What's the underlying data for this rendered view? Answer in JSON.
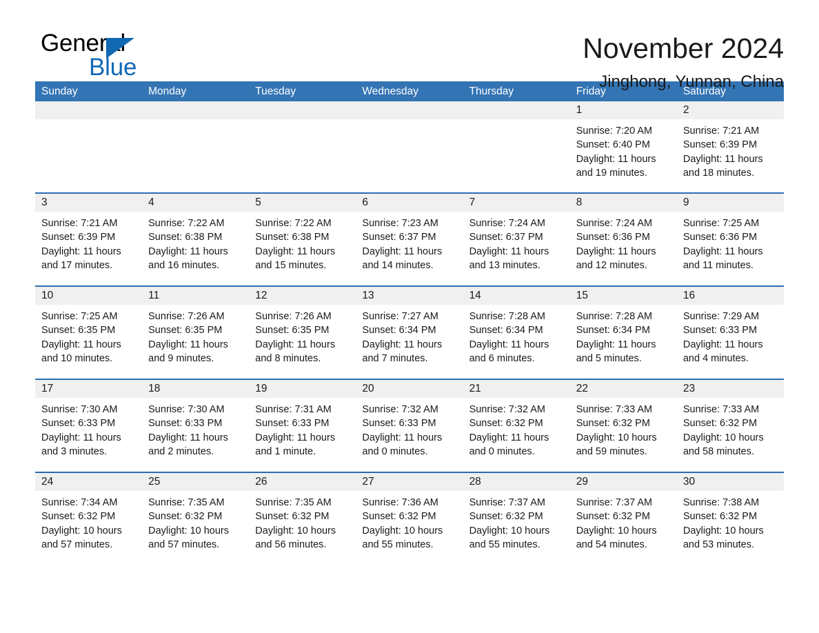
{
  "brand": {
    "name_part1": "General",
    "name_part2": "Blue",
    "triangle_icon": "triangle-logo-icon",
    "accent_color": "#1268b3"
  },
  "header": {
    "title": "November 2024",
    "subtitle": "Jinghong, Yunnan, China"
  },
  "theme": {
    "header_row_color": "#3374b4",
    "row_divider_color": "#2a6db0",
    "day_band_color": "#f0f0f0",
    "text_color": "#1a1a1a"
  },
  "calendar": {
    "weekdays": [
      "Sunday",
      "Monday",
      "Tuesday",
      "Wednesday",
      "Thursday",
      "Friday",
      "Saturday"
    ],
    "weeks": [
      [
        {
          "day": "",
          "empty": true,
          "lines": []
        },
        {
          "day": "",
          "empty": true,
          "lines": []
        },
        {
          "day": "",
          "empty": true,
          "lines": []
        },
        {
          "day": "",
          "empty": true,
          "lines": []
        },
        {
          "day": "",
          "empty": true,
          "lines": []
        },
        {
          "day": "1",
          "empty": false,
          "lines": [
            "Sunrise: 7:20 AM",
            "Sunset: 6:40 PM",
            "Daylight: 11 hours",
            "and 19 minutes."
          ]
        },
        {
          "day": "2",
          "empty": false,
          "lines": [
            "Sunrise: 7:21 AM",
            "Sunset: 6:39 PM",
            "Daylight: 11 hours",
            "and 18 minutes."
          ]
        }
      ],
      [
        {
          "day": "3",
          "empty": false,
          "lines": [
            "Sunrise: 7:21 AM",
            "Sunset: 6:39 PM",
            "Daylight: 11 hours",
            "and 17 minutes."
          ]
        },
        {
          "day": "4",
          "empty": false,
          "lines": [
            "Sunrise: 7:22 AM",
            "Sunset: 6:38 PM",
            "Daylight: 11 hours",
            "and 16 minutes."
          ]
        },
        {
          "day": "5",
          "empty": false,
          "lines": [
            "Sunrise: 7:22 AM",
            "Sunset: 6:38 PM",
            "Daylight: 11 hours",
            "and 15 minutes."
          ]
        },
        {
          "day": "6",
          "empty": false,
          "lines": [
            "Sunrise: 7:23 AM",
            "Sunset: 6:37 PM",
            "Daylight: 11 hours",
            "and 14 minutes."
          ]
        },
        {
          "day": "7",
          "empty": false,
          "lines": [
            "Sunrise: 7:24 AM",
            "Sunset: 6:37 PM",
            "Daylight: 11 hours",
            "and 13 minutes."
          ]
        },
        {
          "day": "8",
          "empty": false,
          "lines": [
            "Sunrise: 7:24 AM",
            "Sunset: 6:36 PM",
            "Daylight: 11 hours",
            "and 12 minutes."
          ]
        },
        {
          "day": "9",
          "empty": false,
          "lines": [
            "Sunrise: 7:25 AM",
            "Sunset: 6:36 PM",
            "Daylight: 11 hours",
            "and 11 minutes."
          ]
        }
      ],
      [
        {
          "day": "10",
          "empty": false,
          "lines": [
            "Sunrise: 7:25 AM",
            "Sunset: 6:35 PM",
            "Daylight: 11 hours",
            "and 10 minutes."
          ]
        },
        {
          "day": "11",
          "empty": false,
          "lines": [
            "Sunrise: 7:26 AM",
            "Sunset: 6:35 PM",
            "Daylight: 11 hours",
            "and 9 minutes."
          ]
        },
        {
          "day": "12",
          "empty": false,
          "lines": [
            "Sunrise: 7:26 AM",
            "Sunset: 6:35 PM",
            "Daylight: 11 hours",
            "and 8 minutes."
          ]
        },
        {
          "day": "13",
          "empty": false,
          "lines": [
            "Sunrise: 7:27 AM",
            "Sunset: 6:34 PM",
            "Daylight: 11 hours",
            "and 7 minutes."
          ]
        },
        {
          "day": "14",
          "empty": false,
          "lines": [
            "Sunrise: 7:28 AM",
            "Sunset: 6:34 PM",
            "Daylight: 11 hours",
            "and 6 minutes."
          ]
        },
        {
          "day": "15",
          "empty": false,
          "lines": [
            "Sunrise: 7:28 AM",
            "Sunset: 6:34 PM",
            "Daylight: 11 hours",
            "and 5 minutes."
          ]
        },
        {
          "day": "16",
          "empty": false,
          "lines": [
            "Sunrise: 7:29 AM",
            "Sunset: 6:33 PM",
            "Daylight: 11 hours",
            "and 4 minutes."
          ]
        }
      ],
      [
        {
          "day": "17",
          "empty": false,
          "lines": [
            "Sunrise: 7:30 AM",
            "Sunset: 6:33 PM",
            "Daylight: 11 hours",
            "and 3 minutes."
          ]
        },
        {
          "day": "18",
          "empty": false,
          "lines": [
            "Sunrise: 7:30 AM",
            "Sunset: 6:33 PM",
            "Daylight: 11 hours",
            "and 2 minutes."
          ]
        },
        {
          "day": "19",
          "empty": false,
          "lines": [
            "Sunrise: 7:31 AM",
            "Sunset: 6:33 PM",
            "Daylight: 11 hours",
            "and 1 minute."
          ]
        },
        {
          "day": "20",
          "empty": false,
          "lines": [
            "Sunrise: 7:32 AM",
            "Sunset: 6:33 PM",
            "Daylight: 11 hours",
            "and 0 minutes."
          ]
        },
        {
          "day": "21",
          "empty": false,
          "lines": [
            "Sunrise: 7:32 AM",
            "Sunset: 6:32 PM",
            "Daylight: 11 hours",
            "and 0 minutes."
          ]
        },
        {
          "day": "22",
          "empty": false,
          "lines": [
            "Sunrise: 7:33 AM",
            "Sunset: 6:32 PM",
            "Daylight: 10 hours",
            "and 59 minutes."
          ]
        },
        {
          "day": "23",
          "empty": false,
          "lines": [
            "Sunrise: 7:33 AM",
            "Sunset: 6:32 PM",
            "Daylight: 10 hours",
            "and 58 minutes."
          ]
        }
      ],
      [
        {
          "day": "24",
          "empty": false,
          "lines": [
            "Sunrise: 7:34 AM",
            "Sunset: 6:32 PM",
            "Daylight: 10 hours",
            "and 57 minutes."
          ]
        },
        {
          "day": "25",
          "empty": false,
          "lines": [
            "Sunrise: 7:35 AM",
            "Sunset: 6:32 PM",
            "Daylight: 10 hours",
            "and 57 minutes."
          ]
        },
        {
          "day": "26",
          "empty": false,
          "lines": [
            "Sunrise: 7:35 AM",
            "Sunset: 6:32 PM",
            "Daylight: 10 hours",
            "and 56 minutes."
          ]
        },
        {
          "day": "27",
          "empty": false,
          "lines": [
            "Sunrise: 7:36 AM",
            "Sunset: 6:32 PM",
            "Daylight: 10 hours",
            "and 55 minutes."
          ]
        },
        {
          "day": "28",
          "empty": false,
          "lines": [
            "Sunrise: 7:37 AM",
            "Sunset: 6:32 PM",
            "Daylight: 10 hours",
            "and 55 minutes."
          ]
        },
        {
          "day": "29",
          "empty": false,
          "lines": [
            "Sunrise: 7:37 AM",
            "Sunset: 6:32 PM",
            "Daylight: 10 hours",
            "and 54 minutes."
          ]
        },
        {
          "day": "30",
          "empty": false,
          "lines": [
            "Sunrise: 7:38 AM",
            "Sunset: 6:32 PM",
            "Daylight: 10 hours",
            "and 53 minutes."
          ]
        }
      ]
    ]
  }
}
